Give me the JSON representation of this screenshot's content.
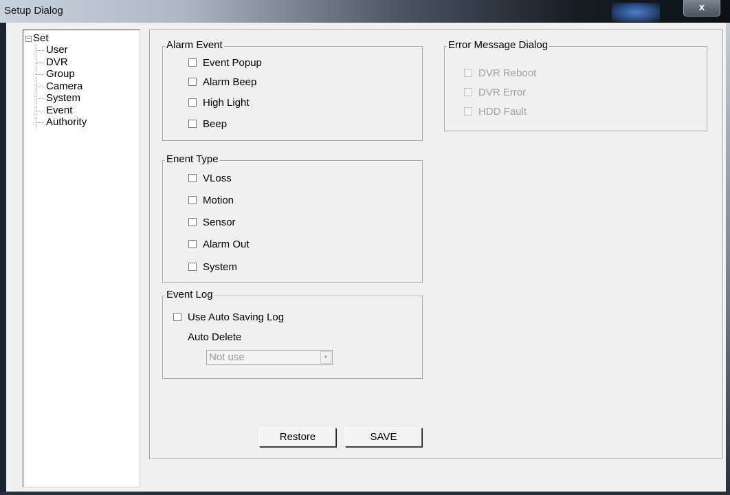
{
  "window": {
    "title": "Setup Dialog",
    "close_label": "x"
  },
  "tree": {
    "root_label": "Set",
    "expander": "−",
    "items": [
      "User",
      "DVR",
      "Group",
      "Camera",
      "System",
      "Event",
      "Authority"
    ]
  },
  "alarm_event": {
    "legend": "Alarm Event",
    "items": [
      "Event Popup",
      "Alarm Beep",
      "High Light",
      "Beep"
    ]
  },
  "event_type": {
    "legend": "Enent Type",
    "items": [
      "VLoss",
      "Motion",
      "Sensor",
      "Alarm Out",
      "System"
    ]
  },
  "event_log": {
    "legend": "Event Log",
    "auto_saving_label": "Use Auto Saving Log",
    "auto_delete_label": "Auto Delete",
    "auto_delete_value": "Not use",
    "arrow": "▼"
  },
  "error_dialog": {
    "legend": "Error Message Dialog",
    "items": [
      "DVR Reboot",
      "DVR Error",
      "HDD Fault"
    ]
  },
  "buttons": {
    "restore": "Restore",
    "save": "SAVE"
  }
}
